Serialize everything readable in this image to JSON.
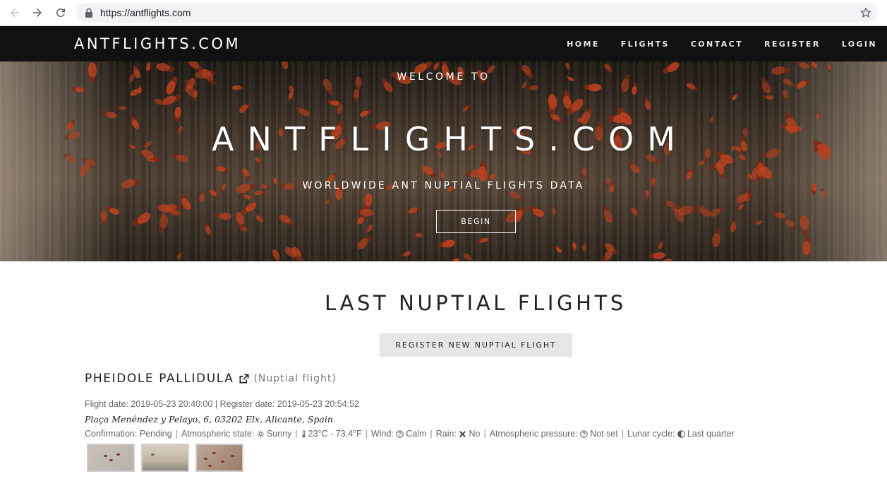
{
  "browser": {
    "url": "https://antflights.com"
  },
  "site": {
    "brand": "ANTFLIGHTS.COM",
    "menu": [
      {
        "label": "HOME"
      },
      {
        "label": "FLIGHTS"
      },
      {
        "label": "CONTACT"
      },
      {
        "label": "REGISTER"
      },
      {
        "label": "LOGIN"
      }
    ]
  },
  "hero": {
    "subtitle": "WELCOME TO",
    "title": "ANTFLIGHTS.COM",
    "tagline": "WORLDWIDE ANT NUPTIAL FLIGHTS DATA",
    "button": "BEGIN"
  },
  "main": {
    "section_title": "LAST NUPTIAL FLIGHTS",
    "register_button": "REGISTER NEW NUPTIAL FLIGHT",
    "flights": [
      {
        "species": "PHEIDOLE PALLIDULA",
        "type": "(Nuptial flight)",
        "flight_date_label": "Flight date:",
        "flight_date": "2019-05-23 20:40:00",
        "register_date_label": "Register date:",
        "register_date": "2019-05-23 20:54:52",
        "address": "Plaça Menéndez y Pelayo, 6, 03202 Elx, Alicante, Spain",
        "confirmation_label": "Confirmation:",
        "confirmation": "Pending",
        "atmos_label": "Atmospheric state:",
        "atmos": "Sunny",
        "temperature": "23°C - 73.4°F",
        "wind_label": "Wind:",
        "wind": "Calm",
        "rain_label": "Rain:",
        "rain": "No",
        "pressure_label": "Atmospheric pressure:",
        "pressure": "Not set",
        "lunar_label": "Lunar cycle:",
        "lunar": "Last quarter"
      }
    ]
  },
  "icons": {
    "back": "arrow-left-icon",
    "forward": "arrow-right-icon",
    "reload": "reload-icon",
    "lock": "lock-icon",
    "bookmark": "star-icon",
    "external": "external-link-icon",
    "sunny": "sun-icon",
    "temperature": "thermometer-icon",
    "wind": "question-circle-icon",
    "rain": "x-icon",
    "pressure": "question-circle-icon",
    "lunar": "half-moon-icon"
  }
}
